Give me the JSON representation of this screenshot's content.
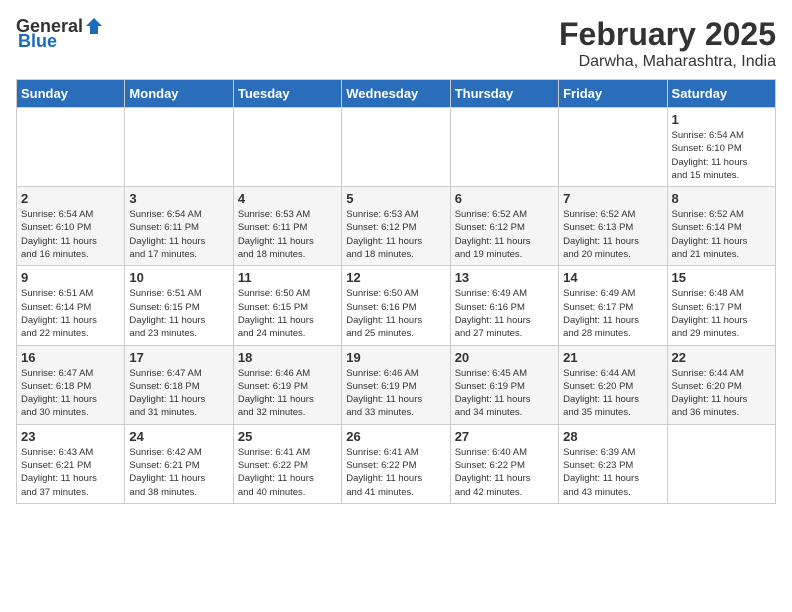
{
  "header": {
    "logo_general": "General",
    "logo_blue": "Blue",
    "month_title": "February 2025",
    "location": "Darwha, Maharashtra, India"
  },
  "weekdays": [
    "Sunday",
    "Monday",
    "Tuesday",
    "Wednesday",
    "Thursday",
    "Friday",
    "Saturday"
  ],
  "weeks": [
    [
      {
        "day": "",
        "info": ""
      },
      {
        "day": "",
        "info": ""
      },
      {
        "day": "",
        "info": ""
      },
      {
        "day": "",
        "info": ""
      },
      {
        "day": "",
        "info": ""
      },
      {
        "day": "",
        "info": ""
      },
      {
        "day": "1",
        "info": "Sunrise: 6:54 AM\nSunset: 6:10 PM\nDaylight: 11 hours\nand 15 minutes."
      }
    ],
    [
      {
        "day": "2",
        "info": "Sunrise: 6:54 AM\nSunset: 6:10 PM\nDaylight: 11 hours\nand 16 minutes."
      },
      {
        "day": "3",
        "info": "Sunrise: 6:54 AM\nSunset: 6:11 PM\nDaylight: 11 hours\nand 17 minutes."
      },
      {
        "day": "4",
        "info": "Sunrise: 6:53 AM\nSunset: 6:11 PM\nDaylight: 11 hours\nand 18 minutes."
      },
      {
        "day": "5",
        "info": "Sunrise: 6:53 AM\nSunset: 6:12 PM\nDaylight: 11 hours\nand 18 minutes."
      },
      {
        "day": "6",
        "info": "Sunrise: 6:52 AM\nSunset: 6:12 PM\nDaylight: 11 hours\nand 19 minutes."
      },
      {
        "day": "7",
        "info": "Sunrise: 6:52 AM\nSunset: 6:13 PM\nDaylight: 11 hours\nand 20 minutes."
      },
      {
        "day": "8",
        "info": "Sunrise: 6:52 AM\nSunset: 6:14 PM\nDaylight: 11 hours\nand 21 minutes."
      }
    ],
    [
      {
        "day": "9",
        "info": "Sunrise: 6:51 AM\nSunset: 6:14 PM\nDaylight: 11 hours\nand 22 minutes."
      },
      {
        "day": "10",
        "info": "Sunrise: 6:51 AM\nSunset: 6:15 PM\nDaylight: 11 hours\nand 23 minutes."
      },
      {
        "day": "11",
        "info": "Sunrise: 6:50 AM\nSunset: 6:15 PM\nDaylight: 11 hours\nand 24 minutes."
      },
      {
        "day": "12",
        "info": "Sunrise: 6:50 AM\nSunset: 6:16 PM\nDaylight: 11 hours\nand 25 minutes."
      },
      {
        "day": "13",
        "info": "Sunrise: 6:49 AM\nSunset: 6:16 PM\nDaylight: 11 hours\nand 27 minutes."
      },
      {
        "day": "14",
        "info": "Sunrise: 6:49 AM\nSunset: 6:17 PM\nDaylight: 11 hours\nand 28 minutes."
      },
      {
        "day": "15",
        "info": "Sunrise: 6:48 AM\nSunset: 6:17 PM\nDaylight: 11 hours\nand 29 minutes."
      }
    ],
    [
      {
        "day": "16",
        "info": "Sunrise: 6:47 AM\nSunset: 6:18 PM\nDaylight: 11 hours\nand 30 minutes."
      },
      {
        "day": "17",
        "info": "Sunrise: 6:47 AM\nSunset: 6:18 PM\nDaylight: 11 hours\nand 31 minutes."
      },
      {
        "day": "18",
        "info": "Sunrise: 6:46 AM\nSunset: 6:19 PM\nDaylight: 11 hours\nand 32 minutes."
      },
      {
        "day": "19",
        "info": "Sunrise: 6:46 AM\nSunset: 6:19 PM\nDaylight: 11 hours\nand 33 minutes."
      },
      {
        "day": "20",
        "info": "Sunrise: 6:45 AM\nSunset: 6:19 PM\nDaylight: 11 hours\nand 34 minutes."
      },
      {
        "day": "21",
        "info": "Sunrise: 6:44 AM\nSunset: 6:20 PM\nDaylight: 11 hours\nand 35 minutes."
      },
      {
        "day": "22",
        "info": "Sunrise: 6:44 AM\nSunset: 6:20 PM\nDaylight: 11 hours\nand 36 minutes."
      }
    ],
    [
      {
        "day": "23",
        "info": "Sunrise: 6:43 AM\nSunset: 6:21 PM\nDaylight: 11 hours\nand 37 minutes."
      },
      {
        "day": "24",
        "info": "Sunrise: 6:42 AM\nSunset: 6:21 PM\nDaylight: 11 hours\nand 38 minutes."
      },
      {
        "day": "25",
        "info": "Sunrise: 6:41 AM\nSunset: 6:22 PM\nDaylight: 11 hours\nand 40 minutes."
      },
      {
        "day": "26",
        "info": "Sunrise: 6:41 AM\nSunset: 6:22 PM\nDaylight: 11 hours\nand 41 minutes."
      },
      {
        "day": "27",
        "info": "Sunrise: 6:40 AM\nSunset: 6:22 PM\nDaylight: 11 hours\nand 42 minutes."
      },
      {
        "day": "28",
        "info": "Sunrise: 6:39 AM\nSunset: 6:23 PM\nDaylight: 11 hours\nand 43 minutes."
      },
      {
        "day": "",
        "info": ""
      }
    ]
  ]
}
